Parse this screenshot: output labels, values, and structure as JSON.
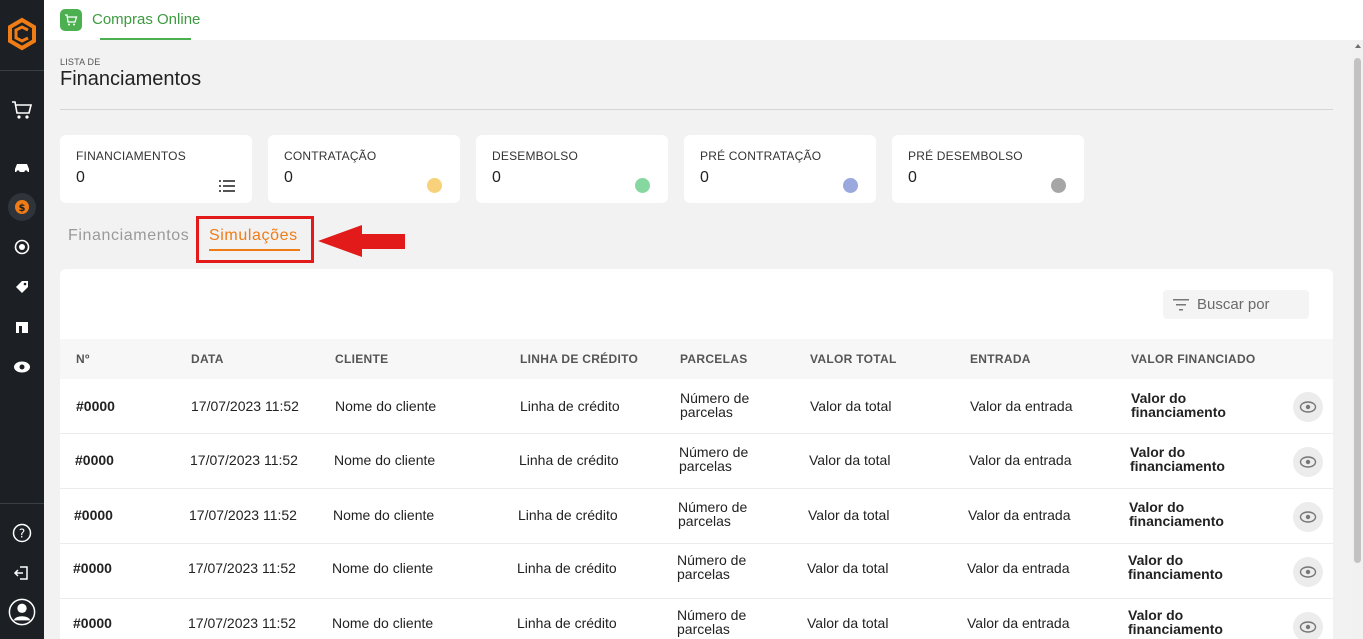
{
  "app": {
    "tab_label": "Compras Online",
    "tab_icon": "cart-icon",
    "accent_green": "#4caf50",
    "accent_orange": "#f07c16"
  },
  "sidebar": {
    "items": [
      {
        "name": "logo",
        "icon": "logo-icon"
      },
      {
        "name": "cart",
        "icon": "cart-icon"
      },
      {
        "name": "vehicle",
        "icon": "car-icon"
      },
      {
        "name": "finance",
        "icon": "dollar-coin-icon",
        "active": true
      },
      {
        "name": "exchange",
        "icon": "exchange-icon"
      },
      {
        "name": "tag",
        "icon": "tag-icon"
      },
      {
        "name": "store",
        "icon": "store-icon"
      },
      {
        "name": "view",
        "icon": "eye-icon"
      },
      {
        "name": "help",
        "icon": "help-icon"
      },
      {
        "name": "logout",
        "icon": "logout-icon"
      },
      {
        "name": "profile",
        "icon": "user-icon"
      }
    ]
  },
  "header": {
    "subtitle": "LISTA DE",
    "title": "Financiamentos"
  },
  "cards": [
    {
      "label": "FINANCIAMENTOS",
      "value": "0",
      "icon": "list-icon"
    },
    {
      "label": "CONTRATAÇÃO",
      "value": "0",
      "color": "#f8d27a"
    },
    {
      "label": "DESEMBOLSO",
      "value": "0",
      "color": "#86d7a0"
    },
    {
      "label": "PRÉ CONTRATAÇÃO",
      "value": "0",
      "color": "#9aa8de"
    },
    {
      "label": "PRÉ DESEMBOLSO",
      "value": "0",
      "color": "#a6a6a6"
    }
  ],
  "tabs": {
    "financiamentos": "Financiamentos",
    "simulacoes": "Simulações",
    "active": "simulacoes"
  },
  "search": {
    "label": "Buscar por"
  },
  "table": {
    "columns": [
      "Nº",
      "DATA",
      "CLIENTE",
      "LINHA DE CRÉDITO",
      "PARCELAS",
      "VALOR TOTAL",
      "ENTRADA",
      "VALOR FINANCIADO"
    ],
    "rows": [
      {
        "id": "#0000",
        "date": "17/07/2023 11:52",
        "client": "Nome do cliente",
        "credit": "Linha de crédito",
        "parcelas_1": "Número de",
        "parcelas_2": "parcelas",
        "total": "Valor da total",
        "entrada": "Valor da entrada",
        "financiado_1": "Valor do",
        "financiado_2": "financiamento"
      },
      {
        "id": "#0000",
        "date": "17/07/2023 11:52",
        "client": "Nome do cliente",
        "credit": "Linha de crédito",
        "parcelas_1": "Número de",
        "parcelas_2": "parcelas",
        "total": "Valor da total",
        "entrada": "Valor da entrada",
        "financiado_1": "Valor do",
        "financiado_2": "financiamento"
      },
      {
        "id": "#0000",
        "date": "17/07/2023 11:52",
        "client": "Nome do cliente",
        "credit": "Linha de crédito",
        "parcelas_1": "Número de",
        "parcelas_2": "parcelas",
        "total": "Valor da total",
        "entrada": "Valor da entrada",
        "financiado_1": "Valor do",
        "financiado_2": "financiamento"
      },
      {
        "id": "#0000",
        "date": "17/07/2023 11:52",
        "client": "Nome do cliente",
        "credit": "Linha de crédito",
        "parcelas_1": "Número de",
        "parcelas_2": "parcelas",
        "total": "Valor da total",
        "entrada": "Valor da entrada",
        "financiado_1": "Valor do",
        "financiado_2": "financiamento"
      },
      {
        "id": "#0000",
        "date": "17/07/2023 11:52",
        "client": "Nome do cliente",
        "credit": "Linha de crédito",
        "parcelas_1": "Número de",
        "parcelas_2": "parcelas",
        "total": "Valor da total",
        "entrada": "Valor da entrada",
        "financiado_1": "Valor do",
        "financiado_2": "financiamento"
      }
    ]
  }
}
